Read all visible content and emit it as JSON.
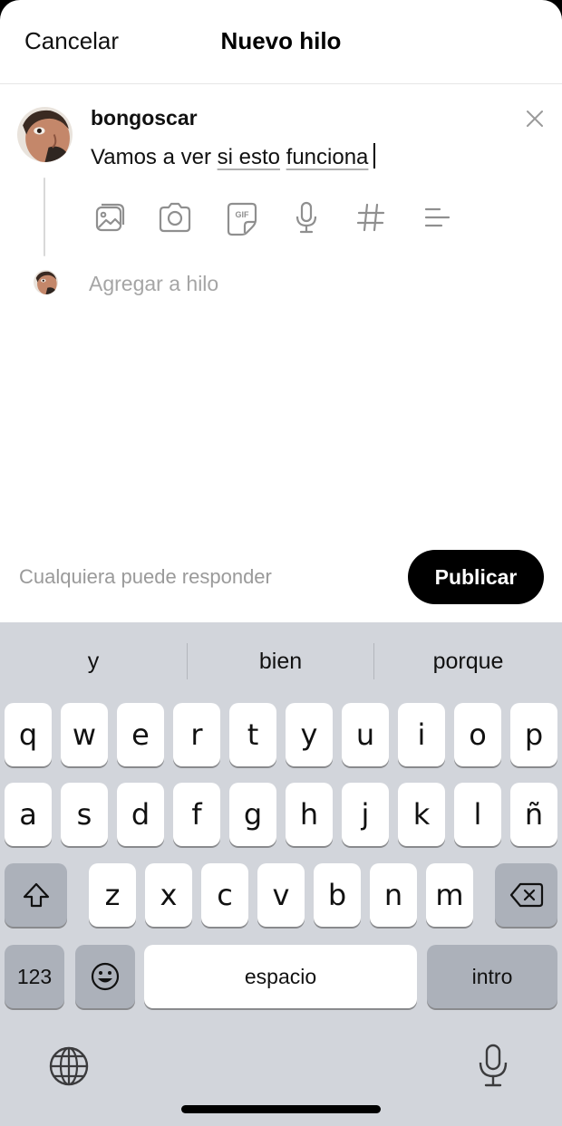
{
  "header": {
    "cancel_label": "Cancelar",
    "title": "Nuevo hilo"
  },
  "composer": {
    "username": "bongoscar",
    "text_plain": "Vamos a ver ",
    "text_underlined_1": "si esto",
    "text_space": " ",
    "text_underlined_2": "funciona",
    "toolbar_icons": [
      "gallery-icon",
      "camera-icon",
      "gif-icon",
      "microphone-icon",
      "hashtag-icon",
      "list-icon"
    ],
    "add_thread_placeholder": "Agregar a hilo"
  },
  "footer": {
    "reply_permission": "Cualquiera puede responder",
    "publish_label": "Publicar"
  },
  "keyboard": {
    "suggestions": [
      "y",
      "bien",
      "porque"
    ],
    "row1": [
      "q",
      "w",
      "e",
      "r",
      "t",
      "y",
      "u",
      "i",
      "o",
      "p"
    ],
    "row2": [
      "a",
      "s",
      "d",
      "f",
      "g",
      "h",
      "j",
      "k",
      "l",
      "ñ"
    ],
    "row3": [
      "z",
      "x",
      "c",
      "v",
      "b",
      "n",
      "m"
    ],
    "numbers_label": "123",
    "space_label": "espacio",
    "return_label": "intro"
  }
}
